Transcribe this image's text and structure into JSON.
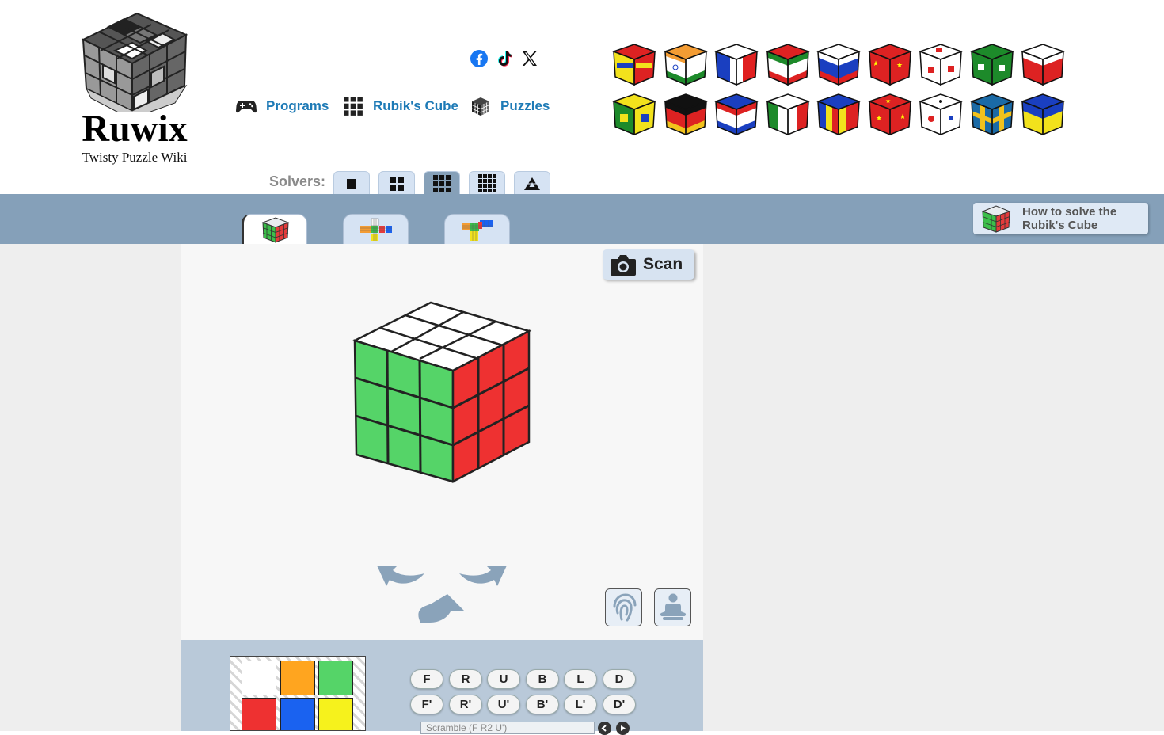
{
  "brand": {
    "name": "Ruwix",
    "tagline": "Twisty Puzzle Wiki"
  },
  "nav": [
    {
      "label": "Programs",
      "icon": "gamepad-icon"
    },
    {
      "label": "Rubik's Cube",
      "icon": "grid-icon"
    },
    {
      "label": "Puzzles",
      "icon": "cube-icon"
    }
  ],
  "social": [
    "facebook-icon",
    "tiktok-icon",
    "x-icon"
  ],
  "solvers": {
    "label": "Solvers:",
    "items": [
      "2x2",
      "3x3",
      "4x4",
      "5x5",
      "pyraminx"
    ],
    "active": "4x4"
  },
  "howto": {
    "label": "How to solve the Rubik's Cube"
  },
  "scan": {
    "label": "Scan"
  },
  "palette": [
    "#ffffff",
    "#ffa51f",
    "#55d468",
    "#ee3131",
    "#1a62f0",
    "#f6f21c"
  ],
  "moves": {
    "row1": [
      "F",
      "R",
      "U",
      "B",
      "L",
      "D"
    ],
    "row2": [
      "F'",
      "R'",
      "U'",
      "B'",
      "L'",
      "D'"
    ]
  },
  "scramble": {
    "placeholder": "Scramble (F R2 U')"
  },
  "colors": {
    "link": "#1d7ab6",
    "bar": "#85a0b9",
    "tab": "#d6e3f3",
    "panel": "#b9c9d9"
  }
}
